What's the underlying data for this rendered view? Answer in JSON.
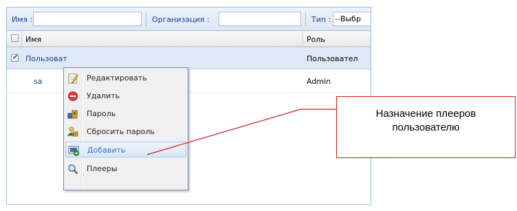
{
  "filters": {
    "name_label": "Имя :",
    "name_value": "",
    "org_label": "Организация :",
    "org_value": "",
    "type_label": "Тип :",
    "type_value": "--Выбр"
  },
  "grid": {
    "columns": {
      "name": "Имя",
      "role": "Роль"
    },
    "rows": [
      {
        "name": "Пользователь",
        "role": "Пользовател",
        "checked": true,
        "selected": true
      },
      {
        "name": "sa",
        "role": "Admin",
        "checked": false,
        "selected": false
      }
    ]
  },
  "context_menu": {
    "items": [
      {
        "label": "Редактировать",
        "icon": "edit-icon"
      },
      {
        "label": "Удалить",
        "icon": "delete-icon"
      },
      {
        "label": "Пароль",
        "icon": "key-icon"
      },
      {
        "label": "Сбросить пароль",
        "icon": "reset-password-icon"
      },
      {
        "label": "Добавить",
        "icon": "add-player-icon",
        "active": true
      },
      {
        "label": "Плееры",
        "icon": "search-icon"
      }
    ]
  },
  "callout": {
    "line1": "Назначение плееров",
    "line2": "пользователю"
  },
  "colors": {
    "callout_border": "#d01818",
    "link": "#15428b",
    "menu_active_text": "#3a73c6"
  }
}
